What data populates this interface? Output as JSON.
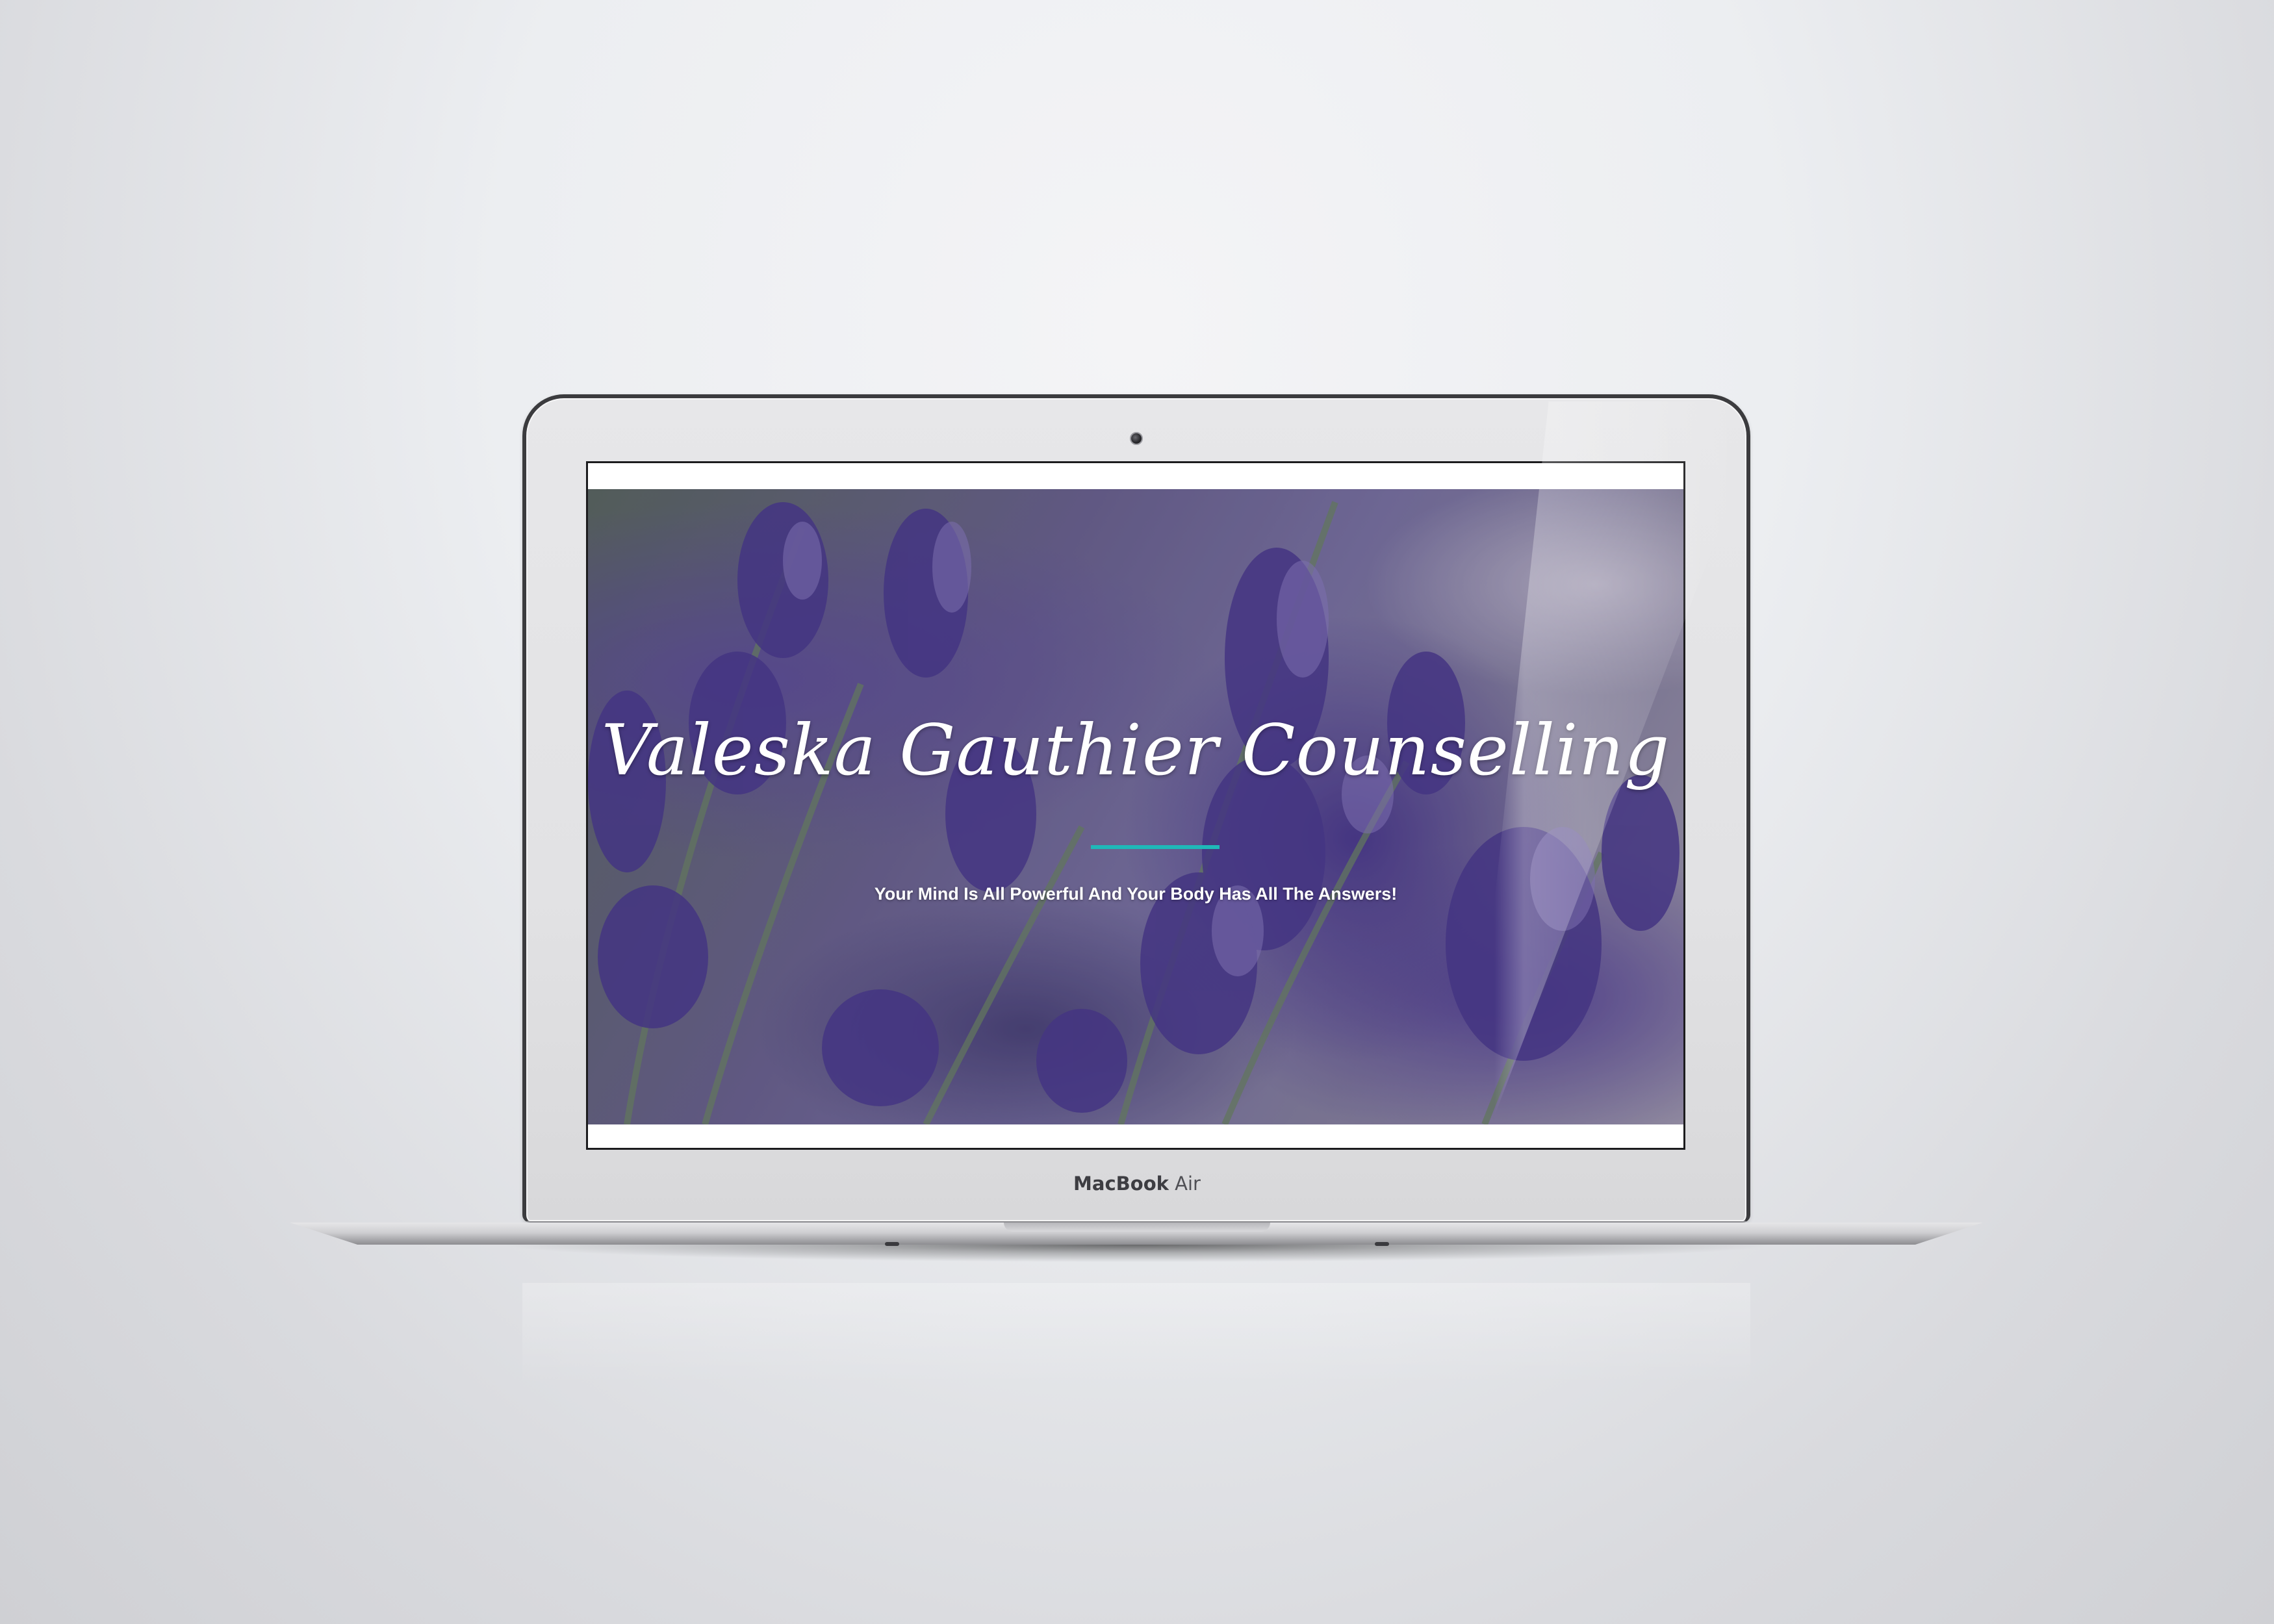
{
  "device": {
    "brand_bold": "MacBook",
    "brand_light": "Air"
  },
  "website": {
    "title": "Valeska Gauthier Counselling",
    "tagline": "Your Mind Is All Powerful And Your Body Has All The Answers!",
    "accent_color": "#1fb8b8",
    "hero_image": "lavender-flowers-image"
  }
}
